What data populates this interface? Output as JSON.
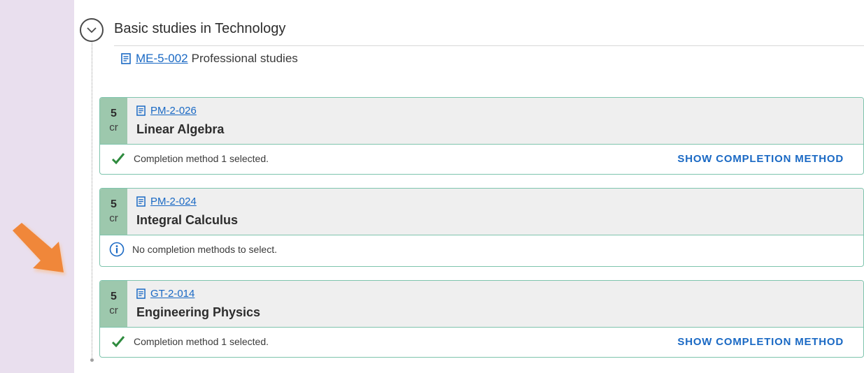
{
  "group": {
    "title": "Basic studies in Technology",
    "module_code": "ME-5-002",
    "module_name": "Professional studies"
  },
  "courses": [
    {
      "credits": "5",
      "unit": "cr",
      "code": "PM-2-026",
      "name": "Linear Algebra",
      "status": "Completion method 1 selected.",
      "status_icon": "check-icon",
      "action": "SHOW COMPLETION METHOD"
    },
    {
      "credits": "5",
      "unit": "cr",
      "code": "PM-2-024",
      "name": "Integral Calculus",
      "status": "No completion methods to select.",
      "status_icon": "info-icon"
    },
    {
      "credits": "5",
      "unit": "cr",
      "code": "GT-2-014",
      "name": "Engineering Physics",
      "status": "Completion method 1 selected.",
      "status_icon": "check-icon",
      "action": "SHOW COMPLETION METHOD"
    }
  ],
  "colors": {
    "background": "#e9dfee",
    "accent_green": "#9dc8ad",
    "border_green": "#7ec4ad",
    "link_blue": "#1a69c4",
    "check_green": "#2e8b3e",
    "arrow_orange": "#f0873a"
  }
}
